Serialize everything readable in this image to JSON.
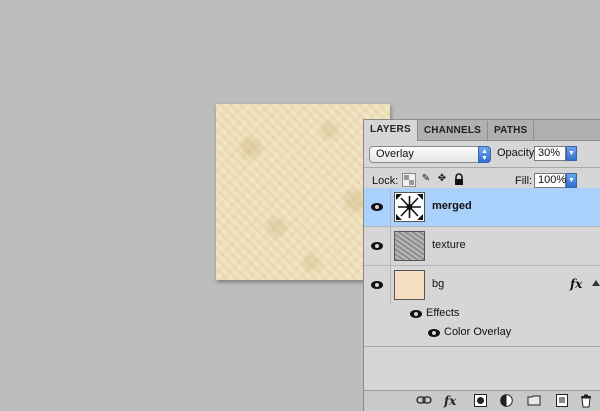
{
  "canvas": {
    "texture_icon": "parchment-texture"
  },
  "panel": {
    "tabs": [
      {
        "label": "LAYERS",
        "active": true
      },
      {
        "label": "CHANNELS",
        "active": false
      },
      {
        "label": "PATHS",
        "active": false
      }
    ],
    "blend_mode": "Overlay",
    "opacity_label": "Opacity:",
    "opacity_value": "30%",
    "lock_label": "Lock:",
    "lock_icons": [
      "transparency-lock-icon",
      "brush-lock-icon",
      "move-lock-icon",
      "padlock-icon"
    ],
    "fill_label": "Fill:",
    "fill_value": "100%",
    "layers": [
      {
        "name": "merged",
        "selected": true,
        "thumb": "star-ornament-icon"
      },
      {
        "name": "texture",
        "selected": false,
        "thumb": "gray-texture"
      },
      {
        "name": "bg",
        "selected": false,
        "thumb": "beige-fill",
        "fx": "fx"
      }
    ],
    "effects_label": "Effects",
    "effect_item": "Color Overlay",
    "footer_icons": [
      "link-icon",
      "fx-icon",
      "mask-icon",
      "adjustment-icon",
      "folder-icon",
      "new-layer-icon",
      "trash-icon"
    ],
    "footer_fx": "fx"
  },
  "colors": {
    "selected_row": "#a9d1fb",
    "accent_blue": "#2f6fd0",
    "bg_swatch": "#f6dfc0",
    "workspace": "#bdbdbd"
  }
}
